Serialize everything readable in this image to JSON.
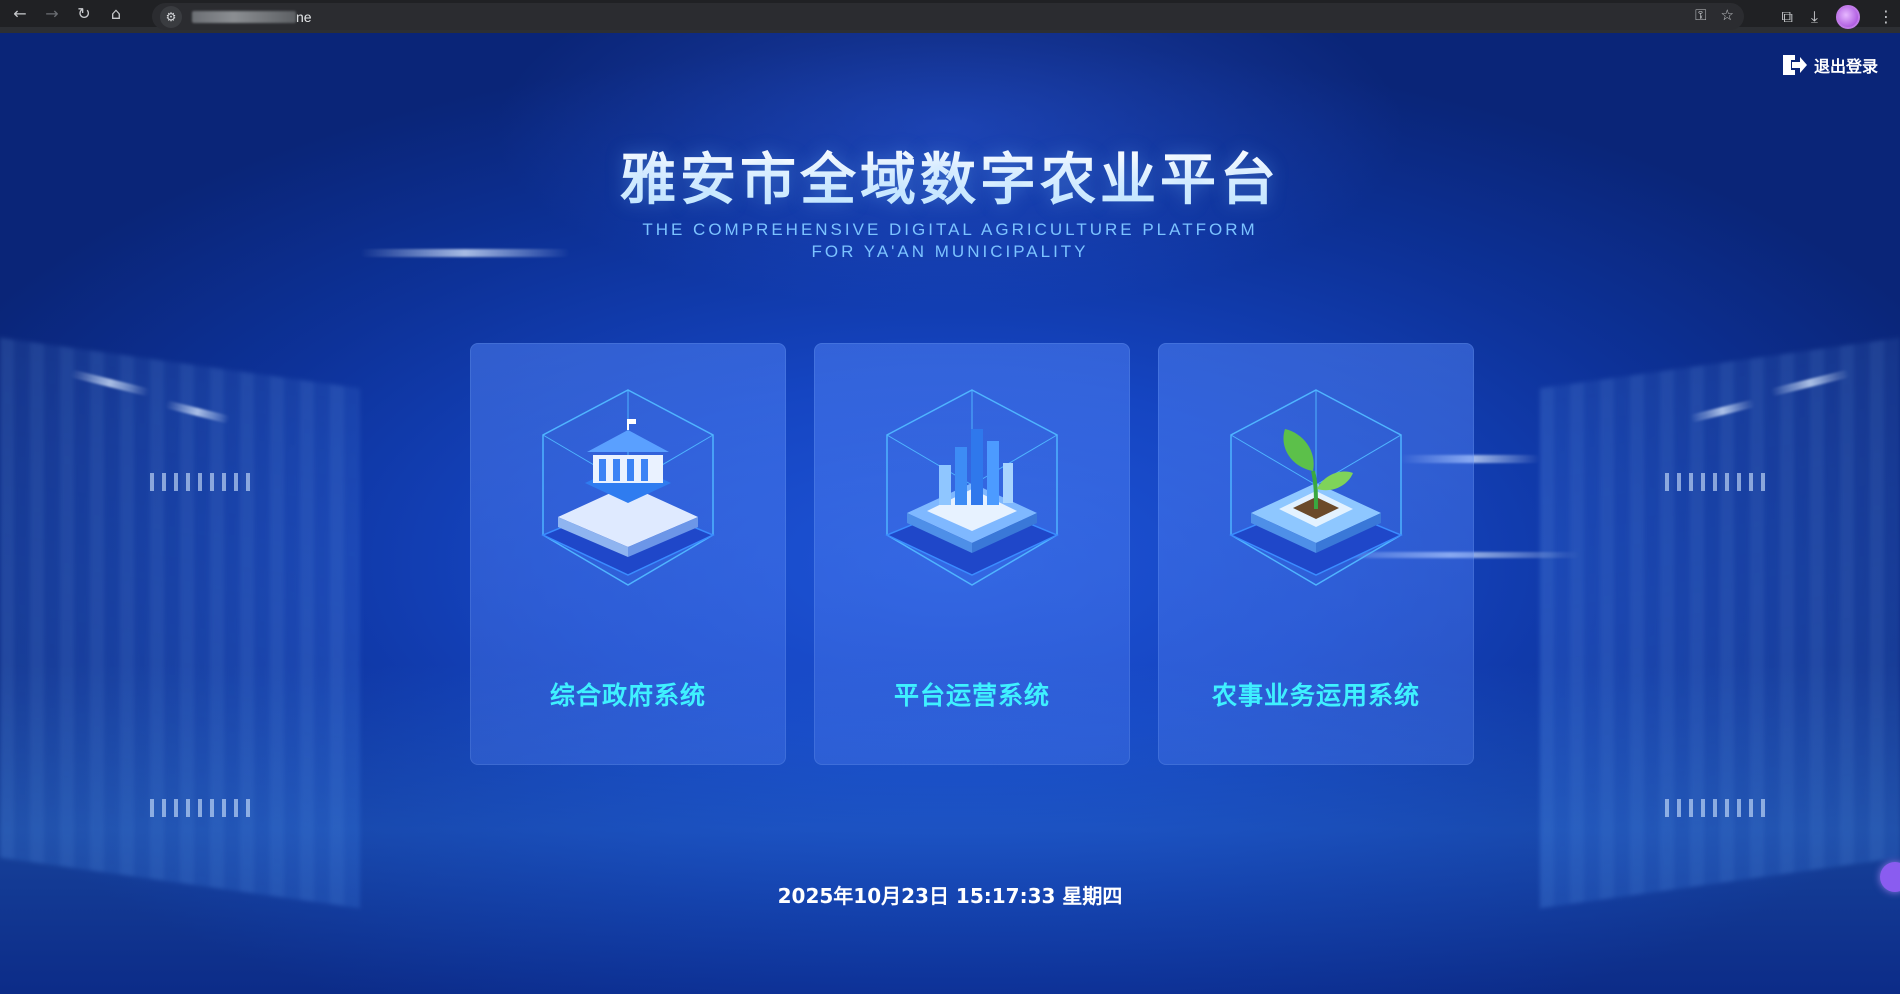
{
  "browser": {
    "url_suffix": "ne"
  },
  "header": {
    "logout_label": "退出登录"
  },
  "hero": {
    "title": "雅安市全域数字农业平台",
    "subtitle_line1": "THE COMPREHENSIVE DIGITAL AGRICULTURE PLATFORM",
    "subtitle_line2": "FOR YA'AN MUNICIPALITY"
  },
  "systems": [
    {
      "label": "综合政府系统",
      "icon": "government-building-icon"
    },
    {
      "label": "平台运营系统",
      "icon": "bar-chart-building-icon"
    },
    {
      "label": "农事业务运用系统",
      "icon": "sprout-icon"
    }
  ],
  "footer": {
    "datetime": "2025年10月23日 15:17:33 星期四"
  },
  "colors": {
    "accent_label": "#3ff0ff",
    "subtitle": "#7cc3ff",
    "background": "#1545c2"
  }
}
